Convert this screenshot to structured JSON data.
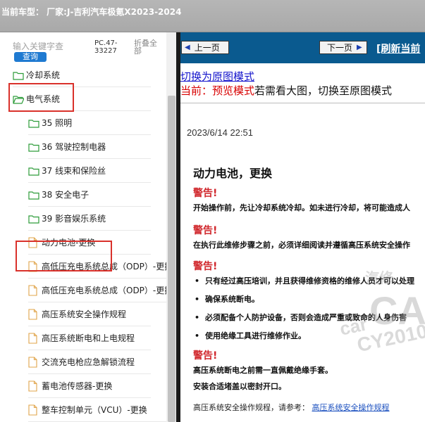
{
  "window": {
    "title": "当前车型：  厂家:J-吉利汽车极氪X2023-2024"
  },
  "search": {
    "placeholder": "输入关键字查",
    "button_label": "查询",
    "model_code": "PC.47-33227",
    "collapse_label": "折叠全部"
  },
  "tree": {
    "items": [
      {
        "label": "冷却系统",
        "icon": "folder-icon"
      },
      {
        "label": "电气系统",
        "icon": "folder-icon"
      },
      {
        "label": "35 照明",
        "icon": "folder-icon"
      },
      {
        "label": "36 驾驶控制电器",
        "icon": "folder-icon"
      },
      {
        "label": "37 线束和保险丝",
        "icon": "folder-icon"
      },
      {
        "label": "38 安全电子",
        "icon": "folder-icon"
      },
      {
        "label": "39 影音娱乐系统",
        "icon": "folder-icon"
      },
      {
        "label": "动力电池-更换",
        "icon": "document-icon"
      },
      {
        "label": "高低压充电系统总成（ODP）-更换",
        "icon": "document-icon"
      },
      {
        "label": "高低压充电系统总成（ODP）-更换",
        "icon": "document-icon"
      },
      {
        "label": "高压系统安全操作规程",
        "icon": "document-icon"
      },
      {
        "label": "高压系统断电和上电规程",
        "icon": "document-icon"
      },
      {
        "label": "交流充电枪应急解锁流程",
        "icon": "document-icon"
      },
      {
        "label": "蓄电池传感器-更换",
        "icon": "document-icon"
      },
      {
        "label": "整车控制单元（VCU）-更换",
        "icon": "document-icon"
      }
    ]
  },
  "nav": {
    "prev_label": "上一页",
    "next_label": "下一页",
    "refresh_label": "[刷新当前",
    "switch_label": "切换为原图模式",
    "mode_prefix": "当前：",
    "mode_name": "预览模式",
    "mode_hint": "若需看大图，切换至原图模式"
  },
  "doc": {
    "date": "2023/6/14 22:51",
    "title": "动力电池，更换",
    "warning_label": "警告!",
    "warning1": "开始操作前，先让冷却系统冷却。如未进行冷却，将可能造成人",
    "warning2": "在执行此维修步骤之前，必须详细阅读并遵循高压系统安全操作",
    "bullets": [
      "只有经过高压培训，并且获得维修资格的维修人员才可以处理",
      "确保系统断电。",
      "必须配备个人防护设备，否则会造成严重或致命的人身伤害",
      "使用绝缘工具进行维修作业。"
    ],
    "warning4a": "高压系统断电之前需一直佩戴绝缘手套。",
    "warning4b": "安装合适堵盖以密封开口。",
    "reference_prefix": "高压系统安全操作规程，请参考：",
    "reference_link": "高压系统安全操作规程"
  },
  "watermark": {
    "text1": "CA",
    "text2": "car",
    "text3": "CY2010",
    "text4": "汽修"
  },
  "colors": {
    "highlight": "#d9312b",
    "nav_bg": "#0a5a8f",
    "warning": "#d0262b",
    "link": "#1414cc"
  }
}
